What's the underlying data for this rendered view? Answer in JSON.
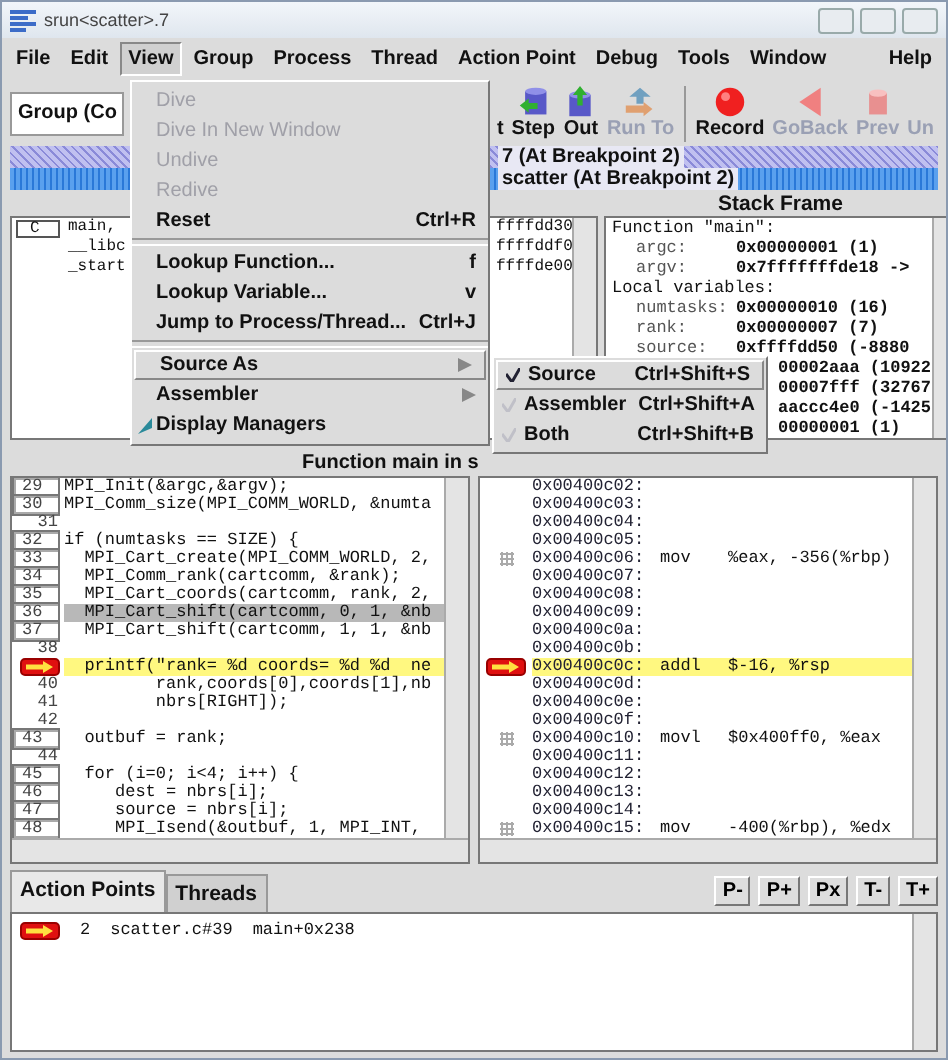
{
  "window": {
    "title": "srun<scatter>.7"
  },
  "menu_bar": [
    {
      "label": "File",
      "selected": false
    },
    {
      "label": "Edit",
      "selected": false
    },
    {
      "label": "View",
      "selected": true
    },
    {
      "label": "Group",
      "selected": false
    },
    {
      "label": "Process",
      "selected": false
    },
    {
      "label": "Thread",
      "selected": false
    },
    {
      "label": "Action Point",
      "selected": false
    },
    {
      "label": "Debug",
      "selected": false
    },
    {
      "label": "Tools",
      "selected": false
    },
    {
      "label": "Window",
      "selected": false
    },
    {
      "label": "Help",
      "selected": false
    }
  ],
  "toolbar": {
    "group_dropdown": "Group (Co",
    "buttons": [
      {
        "label": "t",
        "disabled": false
      },
      {
        "label": "Step",
        "disabled": false
      },
      {
        "label": "Out",
        "disabled": false
      },
      {
        "label": "Run To",
        "disabled": true
      },
      {
        "label": "Record",
        "disabled": false
      },
      {
        "label": "GoBack",
        "disabled": true
      },
      {
        "label": "Prev",
        "disabled": true
      },
      {
        "label": "Un",
        "disabled": true
      }
    ]
  },
  "status_bars": [
    "7 (At Breakpoint 2)",
    "scatter (At Breakpoint 2)"
  ],
  "stack_trace": {
    "language": "C",
    "frames": [
      {
        "name": "main,",
        "address": "ffffdd30"
      },
      {
        "name": "__libc",
        "address": "ffffddf0"
      },
      {
        "name": "_start",
        "address": "ffffde00"
      }
    ]
  },
  "stack_frame": {
    "title": "Stack Frame",
    "lines": [
      {
        "kind": "heading",
        "text": "Function \"main\":"
      },
      {
        "kind": "var",
        "name": "argc:",
        "value": "0x00000001 (1)"
      },
      {
        "kind": "var",
        "name": "argv:",
        "value": "0x7fffffffde18 ->"
      },
      {
        "kind": "heading",
        "text": "Local variables:"
      },
      {
        "kind": "var",
        "name": "numtasks:",
        "value": "0x00000010 (16)"
      },
      {
        "kind": "var",
        "name": "rank:",
        "value": "0x00000007 (7)"
      },
      {
        "kind": "var",
        "name": "source:",
        "value": "0xffffdd50 (-8880"
      },
      {
        "kind": "value",
        "value": "00002aaa (10922"
      },
      {
        "kind": "value",
        "value": "00007fff (32767"
      },
      {
        "kind": "value",
        "value": "aaccc4e0 (-1425"
      },
      {
        "kind": "value",
        "value": "00000001 (1)"
      }
    ]
  },
  "source": {
    "title": "Function main in s",
    "lines": [
      {
        "line": "29",
        "code": "MPI_Init(&argc,&argv);",
        "executable": true,
        "breakpoint": false,
        "current": false,
        "selected": false
      },
      {
        "line": "30",
        "code": "MPI_Comm_size(MPI_COMM_WORLD, &numta",
        "executable": true,
        "breakpoint": false,
        "current": false,
        "selected": false
      },
      {
        "line": "31",
        "executable": false,
        "breakpoint": false,
        "current": false,
        "selected": false
      },
      {
        "line": "32",
        "code": "if (numtasks == SIZE) {",
        "executable": true,
        "breakpoint": false,
        "current": false,
        "selected": false
      },
      {
        "line": "33",
        "code": "  MPI_Cart_create(MPI_COMM_WORLD, 2,",
        "executable": true,
        "breakpoint": false,
        "current": false,
        "selected": false
      },
      {
        "line": "34",
        "code": "  MPI_Comm_rank(cartcomm, &rank);",
        "executable": true,
        "breakpoint": false,
        "current": false,
        "selected": false
      },
      {
        "line": "35",
        "code": "  MPI_Cart_coords(cartcomm, rank, 2,",
        "executable": true,
        "breakpoint": false,
        "current": false,
        "selected": false
      },
      {
        "line": "36",
        "code": "  MPI_Cart_shift(cartcomm, 0, 1, &nb",
        "executable": true,
        "breakpoint": false,
        "current": false,
        "selected": true
      },
      {
        "line": "37",
        "code": "  MPI_Cart_shift(cartcomm, 1, 1, &nb",
        "executable": true,
        "breakpoint": false,
        "current": false,
        "selected": false
      },
      {
        "line": "38",
        "executable": false,
        "breakpoint": false,
        "current": false,
        "selected": false
      },
      {
        "code": "  printf(\"rank= %d coords= %d %d  ne",
        "breakpoint": true,
        "current": true,
        "selected": false
      },
      {
        "line": "40",
        "code": "         rank,coords[0],coords[1],nb",
        "executable": false,
        "breakpoint": false,
        "current": false,
        "selected": false
      },
      {
        "line": "41",
        "code": "         nbrs[RIGHT]);",
        "executable": false,
        "breakpoint": false,
        "current": false,
        "selected": false
      },
      {
        "line": "42",
        "executable": false,
        "breakpoint": false,
        "current": false,
        "selected": false
      },
      {
        "line": "43",
        "code": "  outbuf = rank;",
        "executable": true,
        "breakpoint": false,
        "current": false,
        "selected": false
      },
      {
        "line": "44",
        "executable": false,
        "breakpoint": false,
        "current": false,
        "selected": false
      },
      {
        "line": "45",
        "code": "  for (i=0; i<4; i++) {",
        "executable": true,
        "breakpoint": false,
        "current": false,
        "selected": false
      },
      {
        "line": "46",
        "code": "     dest = nbrs[i];",
        "executable": true,
        "breakpoint": false,
        "current": false,
        "selected": false
      },
      {
        "line": "47",
        "code": "     source = nbrs[i];",
        "executable": true,
        "breakpoint": false,
        "current": false,
        "selected": false
      },
      {
        "line": "48",
        "code": "     MPI_Isend(&outbuf, 1, MPI_INT,",
        "executable": true,
        "breakpoint": false,
        "current": false,
        "selected": false
      }
    ]
  },
  "assembler": {
    "lines": [
      {
        "address": "0x00400c02:",
        "executable": false,
        "breakpoint": false,
        "current": false
      },
      {
        "address": "0x00400c03:",
        "executable": false,
        "breakpoint": false,
        "current": false
      },
      {
        "address": "0x00400c04:",
        "executable": false,
        "breakpoint": false,
        "current": false
      },
      {
        "address": "0x00400c05:",
        "executable": false,
        "breakpoint": false,
        "current": false
      },
      {
        "address": "0x00400c06:",
        "op": "mov",
        "operands": "%eax, -356(%rbp)",
        "executable": true,
        "breakpoint": false,
        "current": false
      },
      {
        "address": "0x00400c07:",
        "executable": false,
        "breakpoint": false,
        "current": false
      },
      {
        "address": "0x00400c08:",
        "executable": false,
        "breakpoint": false,
        "current": false
      },
      {
        "address": "0x00400c09:",
        "executable": false,
        "breakpoint": false,
        "current": false
      },
      {
        "address": "0x00400c0a:",
        "executable": false,
        "breakpoint": false,
        "current": false
      },
      {
        "address": "0x00400c0b:",
        "executable": false,
        "breakpoint": false,
        "current": false
      },
      {
        "address": "0x00400c0c:",
        "op": "addl",
        "operands": "$-16, %rsp",
        "breakpoint": true,
        "current": true
      },
      {
        "address": "0x00400c0d:",
        "executable": false,
        "breakpoint": false,
        "current": false
      },
      {
        "address": "0x00400c0e:",
        "executable": false,
        "breakpoint": false,
        "current": false
      },
      {
        "address": "0x00400c0f:",
        "executable": false,
        "breakpoint": false,
        "current": false
      },
      {
        "address": "0x00400c10:",
        "op": "movl",
        "operands": "$0x400ff0, %eax",
        "executable": true,
        "breakpoint": false,
        "current": false
      },
      {
        "address": "0x00400c11:",
        "executable": false,
        "breakpoint": false,
        "current": false
      },
      {
        "address": "0x00400c12:",
        "executable": false,
        "breakpoint": false,
        "current": false
      },
      {
        "address": "0x00400c13:",
        "executable": false,
        "breakpoint": false,
        "current": false
      },
      {
        "address": "0x00400c14:",
        "executable": false,
        "breakpoint": false,
        "current": false
      },
      {
        "address": "0x00400c15:",
        "op": "mov",
        "operands": "-400(%rbp), %edx",
        "executable": true,
        "breakpoint": false,
        "current": false
      }
    ]
  },
  "bottom_tabs": [
    {
      "label": "Action Points",
      "selected": true
    },
    {
      "label": "Threads",
      "selected": false
    }
  ],
  "bottom_buttons": [
    "P-",
    "P+",
    "Px",
    "T-",
    "T+"
  ],
  "action_points": [
    {
      "id": "2",
      "location": "scatter.c#39",
      "address": "main+0x238",
      "breakpoint": true
    }
  ],
  "view_menu": [
    {
      "kind": "item",
      "label": "Dive",
      "disabled": true,
      "selected": false
    },
    {
      "kind": "item",
      "label": "Dive In New Window",
      "disabled": true,
      "selected": false
    },
    {
      "kind": "item",
      "label": "Undive",
      "disabled": true,
      "selected": false
    },
    {
      "kind": "item",
      "label": "Redive",
      "disabled": true,
      "selected": false
    },
    {
      "kind": "item",
      "label": "Reset",
      "shortcut": "Ctrl+R",
      "disabled": false,
      "selected": false
    },
    {
      "kind": "separator"
    },
    {
      "kind": "item",
      "label": "Lookup Function...",
      "shortcut": "f",
      "disabled": false,
      "selected": false
    },
    {
      "kind": "item",
      "label": "Lookup Variable...",
      "shortcut": "v",
      "disabled": false,
      "selected": false
    },
    {
      "kind": "item",
      "label": "Jump to Process/Thread...",
      "shortcut": "Ctrl+J",
      "disabled": false,
      "selected": false
    },
    {
      "kind": "separator"
    },
    {
      "kind": "submenu",
      "label": "Source As",
      "disabled": false,
      "selected": true
    },
    {
      "kind": "submenu",
      "label": "Assembler",
      "disabled": false,
      "selected": false
    },
    {
      "kind": "check",
      "label": "Display Managers",
      "checked": true,
      "disabled": false,
      "selected": false
    }
  ],
  "source_as_submenu": [
    {
      "label": "Source",
      "shortcut": "Ctrl+Shift+S",
      "checked": true,
      "selected": true
    },
    {
      "label": "Assembler",
      "shortcut": "Ctrl+Shift+A",
      "checked": false,
      "selected": false
    },
    {
      "label": "Both",
      "shortcut": "Ctrl+Shift+B",
      "checked": false,
      "selected": false
    }
  ]
}
